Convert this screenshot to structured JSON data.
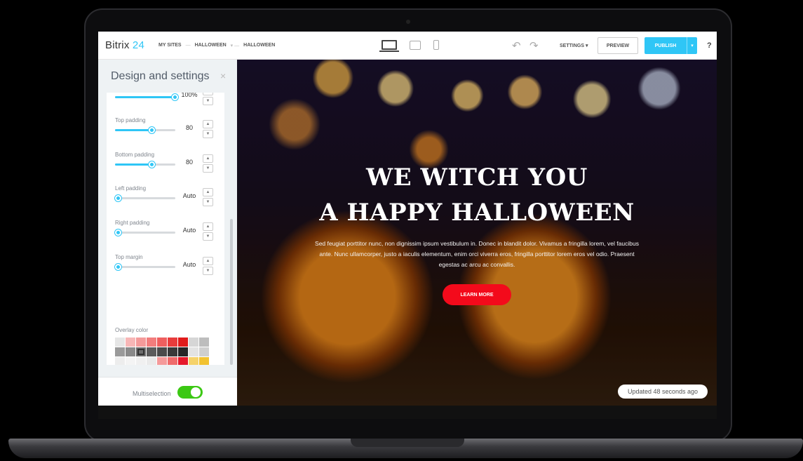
{
  "topbar": {
    "logo_main": "Bitrix",
    "logo_num": "24",
    "breadcrumbs": [
      "MY SITES",
      "HALLOWEEN",
      "HALLOWEEN"
    ],
    "settings_label": "SETTINGS",
    "preview_label": "PREVIEW",
    "publish_label": "PUBLISH",
    "help_label": "?"
  },
  "panel": {
    "title": "Design and settings",
    "close": "×",
    "rows": [
      {
        "label": "",
        "value": "100%",
        "fill": 1.0
      },
      {
        "label": "Top padding",
        "value": "80",
        "fill": 0.62
      },
      {
        "label": "Bottom padding",
        "value": "80",
        "fill": 0.62
      },
      {
        "label": "Left padding",
        "value": "Auto",
        "fill": 0.0
      },
      {
        "label": "Right padding",
        "value": "Auto",
        "fill": 0.0
      },
      {
        "label": "Top margin",
        "value": "Auto",
        "fill": 0.0
      }
    ],
    "overlay_label": "Overlay color",
    "swatches": [
      "#e6e6e6",
      "#f7b6b6",
      "#f49a9a",
      "#f27d7d",
      "#ef5f5f",
      "#e83c3c",
      "#e11b1b",
      "#d6d6d6",
      "#bdbdbd",
      "#9a9a9a",
      "#8a8a8a",
      "#6d6d6d",
      "#5c5c5c",
      "#4a4a4a",
      "#393939",
      "#262626",
      "#e3e3e3",
      "#cfcfcf",
      "#ededed",
      "#f4f4f4",
      "#f0f0f0",
      "#eaeaea",
      "#f59a9a",
      "#ef6b6b",
      "#e6192b",
      "#f5d26a",
      "#f2c230",
      "#f2cc3a",
      "#c8d85a",
      "#a6d05a",
      "#82c652",
      "#5fc9b0",
      "#48c2b2",
      "#2fbfb0",
      "#8adbe6",
      "#5fcde0",
      "#22c4dc",
      "#1fb6d6",
      "#b6d3ee",
      "#8bb8e6",
      "#cfc1ea",
      "#b39ce3",
      "#9d7fde",
      "#8c66d8",
      "#7c4fd2",
      "#c3c3c3",
      "#b0b0b0",
      "#9d9d9d",
      "#8a8a8a",
      "#777777"
    ],
    "multiselection_label": "Multiselection",
    "multiselection_on": true
  },
  "hero": {
    "title_line1": "WE WITCH YOU",
    "title_line2": "A HAPPY HALLOWEEN",
    "body": "Sed feugiat porttitor nunc, non dignissim ipsum vestibulum in. Donec in blandit dolor. Vivamus a fringilla lorem, vel faucibus ante. Nunc ullamcorper, justo a iaculis elementum, enim orci viverra eros, fringilla porttitor lorem eros vel odio. Praesent egestas ac arcu ac convallis.",
    "cta_label": "LEARN MORE",
    "updated": "Updated 48 seconds ago"
  },
  "colors": {
    "accent": "#2fc6f6",
    "cta": "#f30a1b",
    "toggle": "#3bc813"
  }
}
